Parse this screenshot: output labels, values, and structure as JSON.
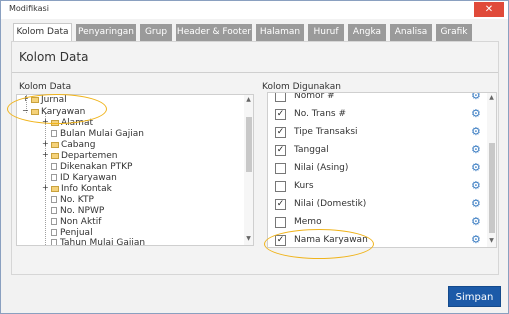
{
  "window": {
    "title": "Modifikasi",
    "close_glyph": "✕"
  },
  "tabs": [
    {
      "label": "Kolom Data",
      "active": true
    },
    {
      "label": "Penyaringan"
    },
    {
      "label": "Grup"
    },
    {
      "label": "Header & Footer"
    },
    {
      "label": "Halaman"
    },
    {
      "label": "Huruf"
    },
    {
      "label": "Angka"
    },
    {
      "label": "Analisa"
    },
    {
      "label": "Grafik"
    }
  ],
  "panel": {
    "title": "Kolom Data"
  },
  "left": {
    "label": "Kolom Data",
    "tree": [
      {
        "label": "Jurnal",
        "icon": "folder-icon",
        "expander": "+"
      },
      {
        "label": "Karyawan",
        "icon": "folder-icon",
        "expander": "−"
      },
      {
        "label": "Alamat",
        "icon": "folder-icon",
        "expander": "+"
      },
      {
        "label": "Bulan Mulai Gajian",
        "icon": "document-icon"
      },
      {
        "label": "Cabang",
        "icon": "folder-icon",
        "expander": "+"
      },
      {
        "label": "Departemen",
        "icon": "folder-icon",
        "expander": "+"
      },
      {
        "label": "Dikenakan PTKP",
        "icon": "document-icon"
      },
      {
        "label": "ID Karyawan",
        "icon": "document-icon"
      },
      {
        "label": "Info Kontak",
        "icon": "folder-icon",
        "expander": "+"
      },
      {
        "label": "No. KTP",
        "icon": "document-icon"
      },
      {
        "label": "No. NPWP",
        "icon": "document-icon"
      },
      {
        "label": "Non Aktif",
        "icon": "document-icon"
      },
      {
        "label": "Penjual",
        "icon": "document-icon"
      },
      {
        "label": "Tahun Mulai Gajian",
        "icon": "document-icon"
      }
    ]
  },
  "right": {
    "label": "Kolom Digunakan",
    "check_glyph": "✓",
    "gear_glyph": "⚙",
    "rows": [
      {
        "label": "Nomor #",
        "checked": false
      },
      {
        "label": "No. Trans #",
        "checked": true
      },
      {
        "label": "Tipe Transaksi",
        "checked": true
      },
      {
        "label": "Tanggal",
        "checked": true
      },
      {
        "label": "Nilai (Asing)",
        "checked": false
      },
      {
        "label": "Kurs",
        "checked": false
      },
      {
        "label": "Nilai (Domestik)",
        "checked": true
      },
      {
        "label": "Memo",
        "checked": false
      },
      {
        "label": "Nama Karyawan",
        "checked": true
      }
    ]
  },
  "footer": {
    "save_label": "Simpan"
  },
  "colors": {
    "accent": "#1c5aa8",
    "highlight": "#f0b41c",
    "tab_inactive": "#9a9a9a"
  }
}
